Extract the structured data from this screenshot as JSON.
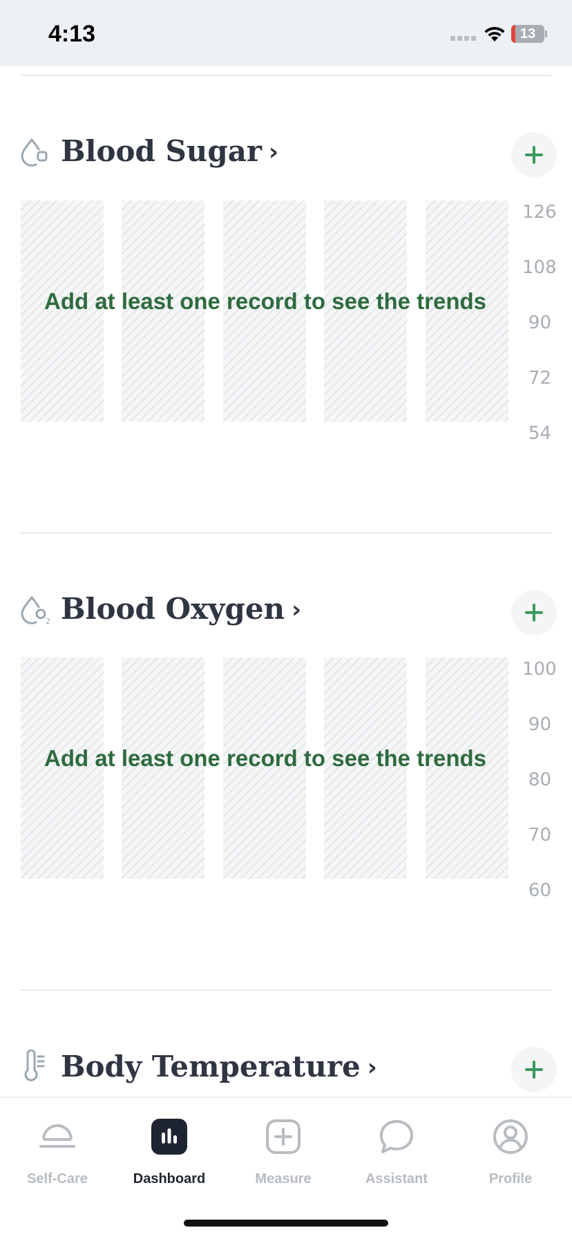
{
  "status_bar": {
    "time": "4:13",
    "battery_level": "13",
    "battery_fraction": 0.13,
    "battery_color": "#e0443a"
  },
  "sections": [
    {
      "title": "Blood Sugar",
      "icon": "drop-sugar-icon",
      "empty_message": "Add at least one record to see the trends",
      "y_ticks": [
        "126",
        "108",
        "90",
        "72",
        "54"
      ]
    },
    {
      "title": "Blood Oxygen",
      "icon": "drop-o2-icon",
      "empty_message": "Add at least one record to see the trends",
      "y_ticks": [
        "100",
        "90",
        "80",
        "70",
        "60"
      ]
    },
    {
      "title": "Body Temperature",
      "icon": "thermometer-icon"
    }
  ],
  "chevron": "›",
  "tab_bar": {
    "active": "Dashboard",
    "tabs": [
      {
        "label": "Self-Care",
        "icon": "self-care-icon"
      },
      {
        "label": "Dashboard",
        "icon": "dashboard-icon"
      },
      {
        "label": "Measure",
        "icon": "measure-plus-icon"
      },
      {
        "label": "Assistant",
        "icon": "chat-bubble-icon"
      },
      {
        "label": "Profile",
        "icon": "profile-icon"
      }
    ]
  },
  "colors": {
    "accent_green": "#3a9a5c",
    "message_green": "#2e6b3e",
    "active_tab": "#1f2530",
    "inactive_tab": "#b7bcc1"
  }
}
